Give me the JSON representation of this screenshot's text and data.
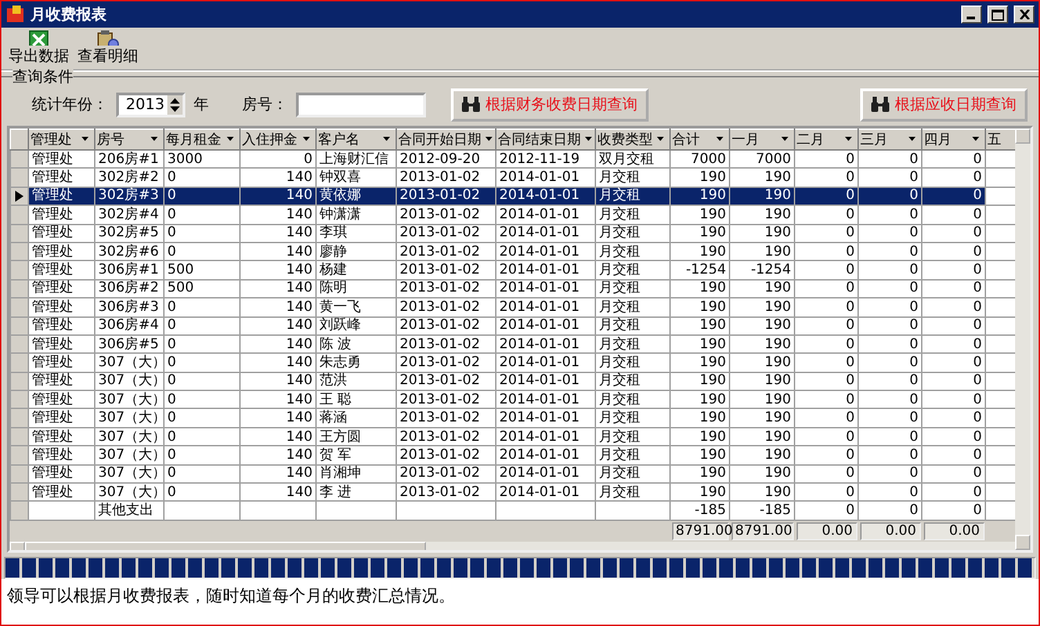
{
  "window": {
    "title": "月收费报表"
  },
  "toolbar": [
    {
      "kind": "excel",
      "label": "导出数据"
    },
    {
      "kind": "detail",
      "label": "查看明细"
    }
  ],
  "query": {
    "title": "查询条件",
    "year_label": "统计年份：",
    "year": "2013",
    "year_unit": "年",
    "room_label": "房号：",
    "buttons": [
      "根据财务收费日期查询",
      "根据应收日期查询"
    ]
  },
  "table": {
    "columns": [
      "管理处",
      "房号",
      "每月租金",
      "入住押金",
      "客户名",
      "合同开始日期",
      "合同结束日期",
      "收费类型",
      "合计",
      "一月",
      "二月",
      "三月",
      "四月",
      "五"
    ],
    "rows": [
      {
        "selected": false,
        "cells": [
          "管理处",
          "206房#1",
          "3000",
          "0",
          "上海财汇信",
          "2012-09-20",
          "2012-11-19",
          "双月交租",
          "7000",
          "7000",
          "0",
          "0",
          "0",
          ""
        ]
      },
      {
        "selected": false,
        "cells": [
          "管理处",
          "302房#2",
          "0",
          "140",
          "钟双喜",
          "2013-01-02",
          "2014-01-01",
          "月交租",
          "190",
          "190",
          "0",
          "0",
          "0",
          ""
        ]
      },
      {
        "selected": true,
        "cells": [
          "管理处",
          "302房#3",
          "0",
          "140",
          "黄依娜",
          "2013-01-02",
          "2014-01-01",
          "月交租",
          "190",
          "190",
          "0",
          "0",
          "0",
          ""
        ]
      },
      {
        "selected": false,
        "cells": [
          "管理处",
          "302房#4",
          "0",
          "140",
          "钟潇潇",
          "2013-01-02",
          "2014-01-01",
          "月交租",
          "190",
          "190",
          "0",
          "0",
          "0",
          ""
        ]
      },
      {
        "selected": false,
        "cells": [
          "管理处",
          "302房#5",
          "0",
          "140",
          "李琪",
          "2013-01-02",
          "2014-01-01",
          "月交租",
          "190",
          "190",
          "0",
          "0",
          "0",
          ""
        ]
      },
      {
        "selected": false,
        "cells": [
          "管理处",
          "302房#6",
          "0",
          "140",
          "廖静",
          "2013-01-02",
          "2014-01-01",
          "月交租",
          "190",
          "190",
          "0",
          "0",
          "0",
          ""
        ]
      },
      {
        "selected": false,
        "cells": [
          "管理处",
          "306房#1",
          "500",
          "140",
          "杨建",
          "2013-01-02",
          "2014-01-01",
          "月交租",
          "-1254",
          "-1254",
          "0",
          "0",
          "0",
          ""
        ]
      },
      {
        "selected": false,
        "cells": [
          "管理处",
          "306房#2",
          "500",
          "140",
          "陈明",
          "2013-01-02",
          "2014-01-01",
          "月交租",
          "190",
          "190",
          "0",
          "0",
          "0",
          ""
        ]
      },
      {
        "selected": false,
        "cells": [
          "管理处",
          "306房#3",
          "0",
          "140",
          "黄一飞",
          "2013-01-02",
          "2014-01-01",
          "月交租",
          "190",
          "190",
          "0",
          "0",
          "0",
          ""
        ]
      },
      {
        "selected": false,
        "cells": [
          "管理处",
          "306房#4",
          "0",
          "140",
          "刘跃峰",
          "2013-01-02",
          "2014-01-01",
          "月交租",
          "190",
          "190",
          "0",
          "0",
          "0",
          ""
        ]
      },
      {
        "selected": false,
        "cells": [
          "管理处",
          "306房#5",
          "0",
          "140",
          "陈 波",
          "2013-01-02",
          "2014-01-01",
          "月交租",
          "190",
          "190",
          "0",
          "0",
          "0",
          ""
        ]
      },
      {
        "selected": false,
        "cells": [
          "管理处",
          "307（大）",
          "0",
          "140",
          "朱志勇",
          "2013-01-02",
          "2014-01-01",
          "月交租",
          "190",
          "190",
          "0",
          "0",
          "0",
          ""
        ]
      },
      {
        "selected": false,
        "cells": [
          "管理处",
          "307（大）",
          "0",
          "140",
          "范洪",
          "2013-01-02",
          "2014-01-01",
          "月交租",
          "190",
          "190",
          "0",
          "0",
          "0",
          ""
        ]
      },
      {
        "selected": false,
        "cells": [
          "管理处",
          "307（大）",
          "0",
          "140",
          "王 聪",
          "2013-01-02",
          "2014-01-01",
          "月交租",
          "190",
          "190",
          "0",
          "0",
          "0",
          ""
        ]
      },
      {
        "selected": false,
        "cells": [
          "管理处",
          "307（大）",
          "0",
          "140",
          "蒋涵",
          "2013-01-02",
          "2014-01-01",
          "月交租",
          "190",
          "190",
          "0",
          "0",
          "0",
          ""
        ]
      },
      {
        "selected": false,
        "cells": [
          "管理处",
          "307（大）",
          "0",
          "140",
          "王方圆",
          "2013-01-02",
          "2014-01-01",
          "月交租",
          "190",
          "190",
          "0",
          "0",
          "0",
          ""
        ]
      },
      {
        "selected": false,
        "cells": [
          "管理处",
          "307（大）",
          "0",
          "140",
          "贺 军",
          "2013-01-02",
          "2014-01-01",
          "月交租",
          "190",
          "190",
          "0",
          "0",
          "0",
          ""
        ]
      },
      {
        "selected": false,
        "cells": [
          "管理处",
          "307（大）",
          "0",
          "140",
          "肖湘坤",
          "2013-01-02",
          "2014-01-01",
          "月交租",
          "190",
          "190",
          "0",
          "0",
          "0",
          ""
        ]
      },
      {
        "selected": false,
        "cells": [
          "管理处",
          "307（大）",
          "0",
          "140",
          "李 进",
          "2013-01-02",
          "2014-01-01",
          "月交租",
          "190",
          "190",
          "0",
          "0",
          "0",
          ""
        ]
      },
      {
        "selected": false,
        "cells": [
          "",
          "其他支出",
          "",
          "",
          "",
          "",
          "",
          "",
          "-185",
          "-185",
          "0",
          "0",
          "0",
          ""
        ]
      }
    ],
    "totals": [
      "8791.00",
      "8791.00",
      "0.00",
      "0.00",
      "0.00"
    ]
  },
  "progress": {
    "level": 1
  },
  "caption": "领导可以根据月收费报表，随时知道每个月的收费汇总情况。"
}
